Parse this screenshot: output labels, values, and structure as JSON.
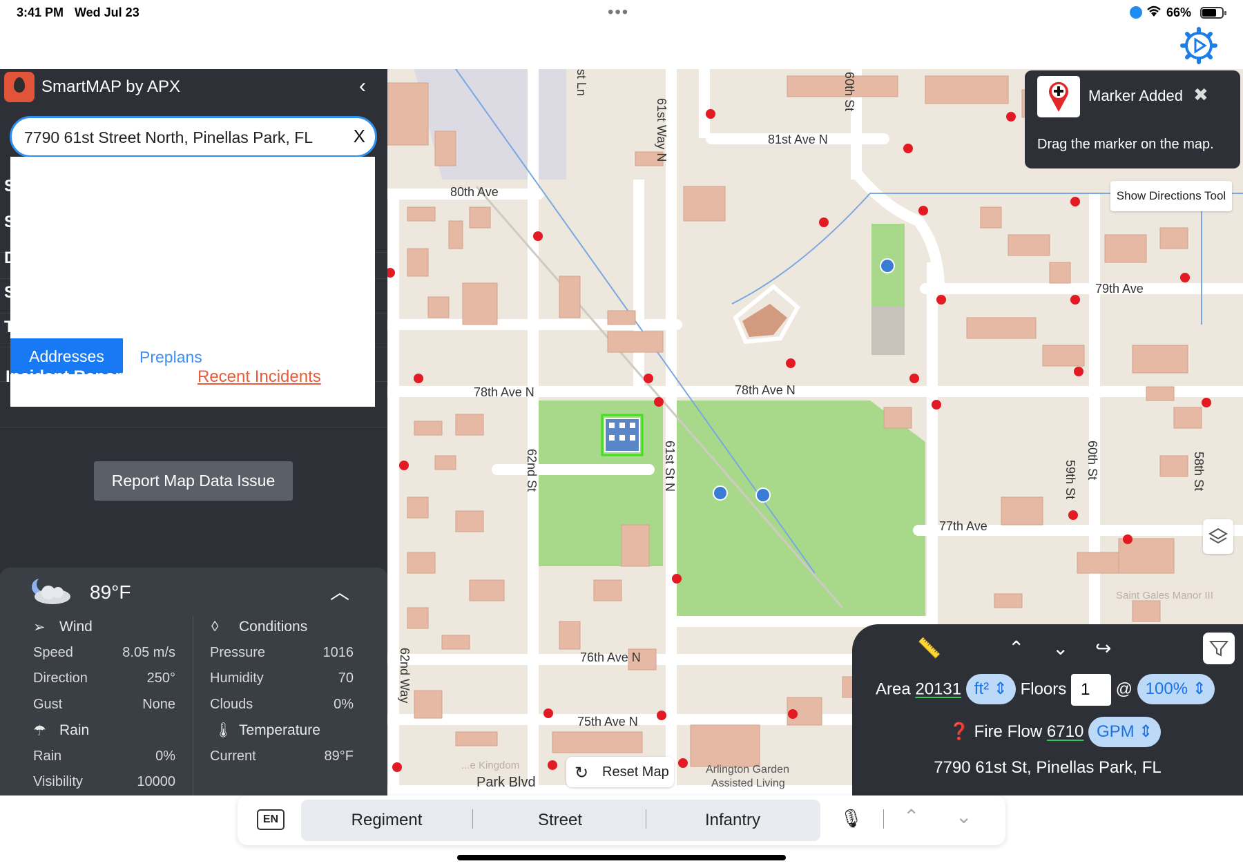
{
  "status_bar": {
    "time": "3:41 PM",
    "date": "Wed Jul 23",
    "battery": "66%"
  },
  "app": {
    "title": "SmartMAP by APX"
  },
  "search": {
    "value": "7790 61st Street North, Pinellas Park, FL",
    "clear_label": "X"
  },
  "hidden_rows": [
    "S",
    "S",
    "D",
    "S",
    "T"
  ],
  "tabs": {
    "addresses": "Addresses",
    "preplans": "Preplans"
  },
  "incident": {
    "report_label": "Incident Report",
    "recent_label": "Recent Incidents"
  },
  "report_button": "Report Map Data Issue",
  "weather": {
    "temp": "89°F",
    "wind": {
      "title": "Wind",
      "rows": [
        {
          "label": "Speed",
          "value": "8.05 m/s"
        },
        {
          "label": "Direction",
          "value": "250°"
        },
        {
          "label": "Gust",
          "value": "None"
        }
      ]
    },
    "rain": {
      "title": "Rain",
      "rows": [
        {
          "label": "Rain",
          "value": "0%"
        },
        {
          "label": "Visibility",
          "value": "10000"
        }
      ]
    },
    "conditions": {
      "title": "Conditions",
      "rows": [
        {
          "label": "Pressure",
          "value": "1016"
        },
        {
          "label": "Humidity",
          "value": "70"
        },
        {
          "label": "Clouds",
          "value": "0%"
        }
      ]
    },
    "temperature": {
      "title": "Temperature",
      "rows": [
        {
          "label": "Current",
          "value": "89°F"
        }
      ]
    }
  },
  "toast": {
    "title": "Marker Added",
    "message": "Drag the marker on the map."
  },
  "directions_button": "Show Directions Tool",
  "reset_map": "Reset Map",
  "map_labels": {
    "ave80": "80th Ave",
    "ave81": "81st Ave N",
    "ave79": "79th Ave",
    "ave78a": "78th Ave N",
    "ave78b": "78th Ave N",
    "ave77": "77th Ave",
    "ave76": "76th Ave N",
    "ave75": "75th Ave N",
    "park_blvd": "Park Blvd",
    "st_ln": "st Ln",
    "st61way": "61st Way N",
    "st60a": "60th St",
    "st60b": "60th St",
    "st62": "62nd St",
    "st61n": "61st St N",
    "st59": "59th St",
    "st58": "58th St",
    "way62": "62nd Way",
    "arlington1": "Arlington Garden",
    "arlington2": "Assisted Living",
    "kingdom": "...e Kingdom",
    "saint_gales": "Saint Gales Manor III"
  },
  "fire_flow": {
    "area_label": "Area",
    "area_value": "20131",
    "area_unit": "ft²",
    "floors_label": "Floors",
    "floors_value": "1",
    "at": "@",
    "percent": "100%",
    "flow_label": "Fire Flow",
    "flow_value": "6710",
    "flow_unit": "GPM",
    "address": "7790 61st St, Pinellas Park, FL"
  },
  "keyboard": {
    "lang": "EN",
    "suggestions": [
      "Regiment",
      "Street",
      "Infantry"
    ]
  }
}
